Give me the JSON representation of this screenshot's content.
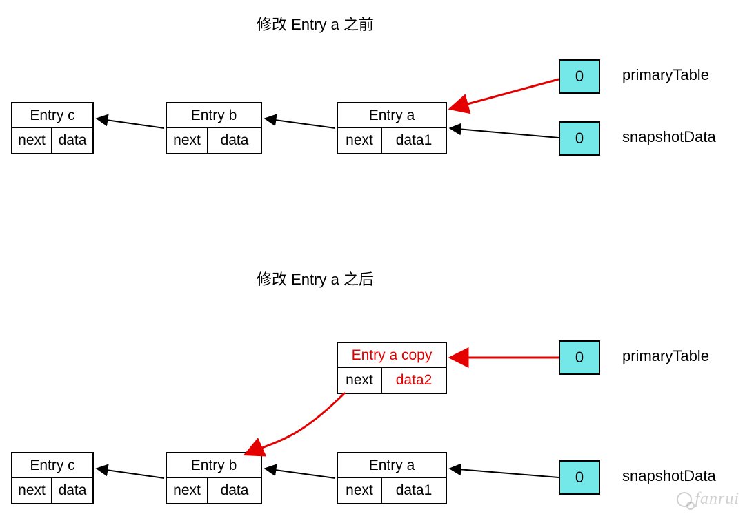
{
  "titles": {
    "before": "修改 Entry a 之前",
    "after": "修改 Entry a 之后"
  },
  "labels": {
    "primaryTable": "primaryTable",
    "snapshotData": "snapshotData",
    "next": "next",
    "data": "data",
    "data1": "data1",
    "data2": "data2",
    "zero": "0"
  },
  "entries": {
    "c": "Entry c",
    "b": "Entry b",
    "a": "Entry a",
    "aCopy": "Entry a copy"
  },
  "watermark": "fanrui"
}
